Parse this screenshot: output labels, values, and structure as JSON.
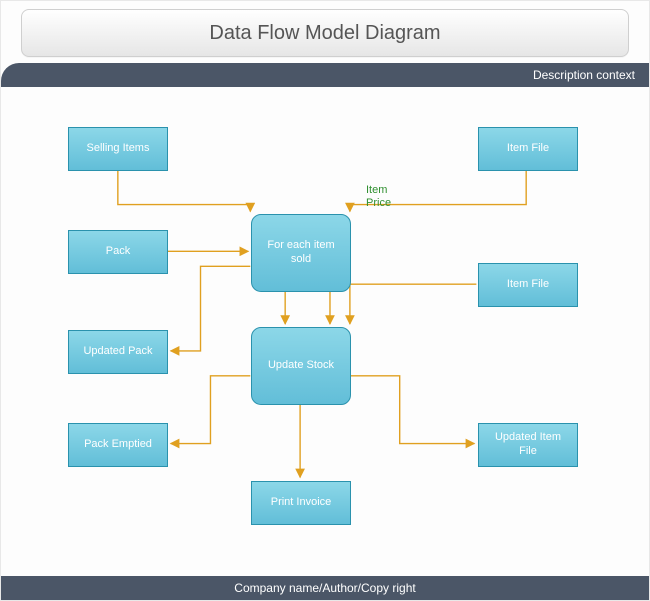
{
  "header": {
    "title": "Data Flow Model Diagram",
    "description": "Description context"
  },
  "footer": {
    "text": "Company name/Author/Copy right"
  },
  "labels": {
    "item_price": "Item\nPrice"
  },
  "nodes": {
    "selling_items": {
      "label": "Selling Items"
    },
    "item_file_top": {
      "label": "Item File"
    },
    "pack": {
      "label": "Pack"
    },
    "for_each_item_sold": {
      "label": "For each item\nsold"
    },
    "item_file_mid": {
      "label": "Item File"
    },
    "updated_pack": {
      "label": "Updated Pack"
    },
    "update_stock": {
      "label": "Update Stock"
    },
    "pack_emptied": {
      "label": "Pack Emptied"
    },
    "updated_item_file": {
      "label": "Updated Item\nFile"
    },
    "print_invoice": {
      "label": "Print Invoice"
    }
  },
  "colors": {
    "node_fill_top": "#8cd7e8",
    "node_fill_bot": "#62bed8",
    "node_border": "#2a92ad",
    "arrow": "#e0a020",
    "bar": "#4b5667",
    "label": "#2f8f2f"
  }
}
